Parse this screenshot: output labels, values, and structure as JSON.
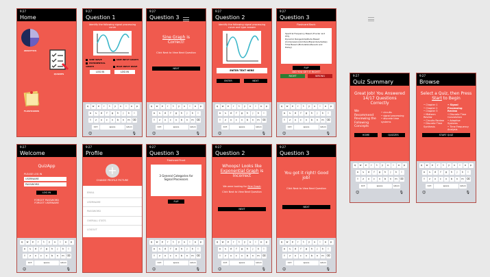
{
  "common": {
    "time": "9:27",
    "keyboard": {
      "row1": [
        "q",
        "w",
        "e",
        "r",
        "t",
        "y",
        "u",
        "i",
        "o",
        "p"
      ],
      "row2": [
        "a",
        "s",
        "d",
        "f",
        "g",
        "h",
        "j",
        "k",
        "l"
      ],
      "row3": [
        "z",
        "x",
        "c",
        "v",
        "b",
        "n",
        "m"
      ],
      "shift": "⇧",
      "delete": "⌫",
      "numbers": "123",
      "space": "space",
      "return": "return",
      "emoji": "☺",
      "mic": "🎙"
    }
  },
  "home": {
    "title": "Home",
    "analytics": "ANALYTICS",
    "quizzes": "QUIZZES",
    "flashcards": "FLASHCARDS"
  },
  "q1": {
    "title": "Question 1",
    "prompt": "Identify the following signal processing curve",
    "options": [
      "SINE WAVE",
      "SINE INPUT GRAPH",
      "EXPONENTIAL GRAPH",
      "HIGH INPUT WAVE"
    ],
    "log_in": "LOG IN",
    "back": "LOG IN"
  },
  "q3correct": {
    "title": "Question 3",
    "line1": "Sine Graph",
    "line1b": " is",
    "line2": "Correct!",
    "next_hint": "Click Next to View Next Question",
    "next": "NEXT"
  },
  "q2": {
    "title": "Question 2",
    "prompt": "Identify the following signal processing curve and type answer",
    "input_placeholder": "ENTER TEXT HERE",
    "enter": "ENTER",
    "next": "NEXT"
  },
  "q3flash": {
    "title": "Question 3",
    "subtitle": "Flashcard Back:",
    "items": [
      "Spectral Frequency Based (Fourier and FFT)",
      "Dynamic Range/Amplitude Based (Compression/Limiters/Expanders/Gates)",
      "Time Based (Modulation/Reverb and Delay)"
    ],
    "flip": "FLIP",
    "did_you_get": "DID YOU GET IT RIGHT?",
    "right": "RIGHT",
    "wrong": "WRONG"
  },
  "summary": {
    "title": "Quiz Summary",
    "headline": "Great Job! You Answered 14/17 Questions Correctly",
    "recommend": "We Recommend Reviewing the Following Concepts",
    "concepts": [
      "circuits",
      "signal processing",
      "discrete time systems"
    ],
    "home": "HOME",
    "quizzes": "QUIZZES"
  },
  "browse": {
    "title": "Browse",
    "headline_a": "Select a Quiz, then Press ",
    "headline_start": "Start",
    "headline_b": " to Begin",
    "chapters": [
      "Chapter 1",
      "Chapter 2",
      "Chapter 3",
      "Midterm Review",
      "Circuits Review",
      "Discrete Time Synthesis"
    ],
    "topics": [
      "Signal Processing Review",
      "Discrete Time Convolution",
      "Adaptive Systems",
      "Time Frequency Analysis"
    ],
    "start_quiz": "START QUIZ"
  },
  "welcome": {
    "title": "Welcome",
    "app_name": "QuizApp",
    "please_log_in": "PLEASE LOG IN",
    "username_value": "USERNAME",
    "password_value": "PASSWORD",
    "log_in": "LOG IN",
    "forgot_password": "FORGOT PASSWORD",
    "forgot_username": "FORGOT USERNAME"
  },
  "profile": {
    "title": "Profile",
    "change_photo": "CHANGE PROFILE PICTURE",
    "fields": [
      "EMAIL",
      "USERNAME",
      "PASSWORD",
      "OVERALL STATS",
      "LOGOUT"
    ]
  },
  "q3front": {
    "title": "Question 3",
    "subtitle": "Flashcard Front",
    "text": "3 General Categories for Signal Processors",
    "flip": "FLIP"
  },
  "q2wrong": {
    "title": "Question 2",
    "line1": "Whoops! Looks like ",
    "line1_link": "Exponential Graph",
    "line1b": " is Incorrect",
    "looking_for": "We were looking for ",
    "looking_link": "Sine Graph",
    "next_hint": "Click Next to View Next Question",
    "next": "NEXT"
  },
  "q3right": {
    "title": "Question 3",
    "line1": "You got it right! Good job!",
    "next_hint": "Click Next to View Next Question",
    "next": "NEXT"
  }
}
